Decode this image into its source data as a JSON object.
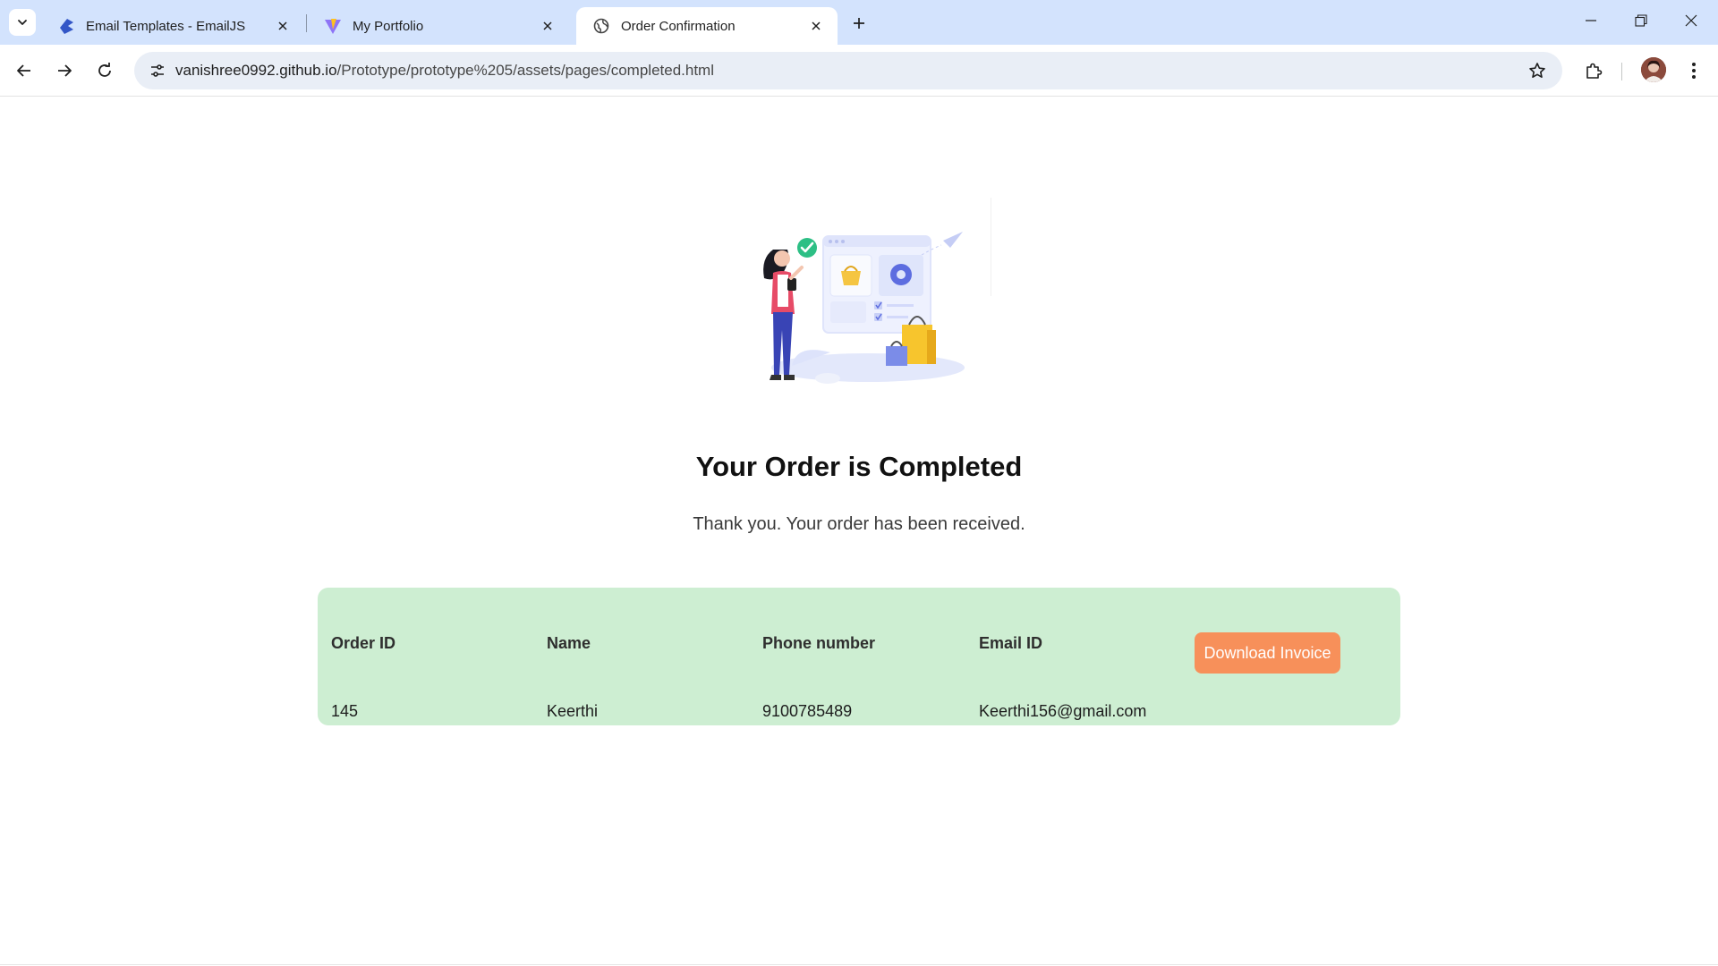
{
  "browser": {
    "tabs": [
      {
        "title": "Email Templates - EmailJS",
        "icon": "emailjs-icon",
        "active": false
      },
      {
        "title": "My Portfolio",
        "icon": "vite-icon",
        "active": false
      },
      {
        "title": "Order Confirmation",
        "icon": "globe-icon",
        "active": true
      }
    ],
    "url_host": "vanishree0992.github.io",
    "url_path": "/Prototype/prototype%205/assets/pages/completed.html",
    "colors": {
      "tabstrip": "#d3e3fd",
      "omnibox": "#e9eef6"
    }
  },
  "page": {
    "title": "Your Order is Completed",
    "subtitle": "Thank you. Your order has been received.",
    "illustration": "order-completed-illustration",
    "order": {
      "headers": [
        "Order ID",
        "Name",
        "Phone number",
        "Email ID"
      ],
      "values": [
        "145",
        "Keerthi",
        "9100785489",
        "Keerthi156@gmail.com"
      ]
    },
    "download_button": "Download Invoice",
    "colors": {
      "card": "#cdeed2",
      "button": "#f7905a"
    }
  }
}
